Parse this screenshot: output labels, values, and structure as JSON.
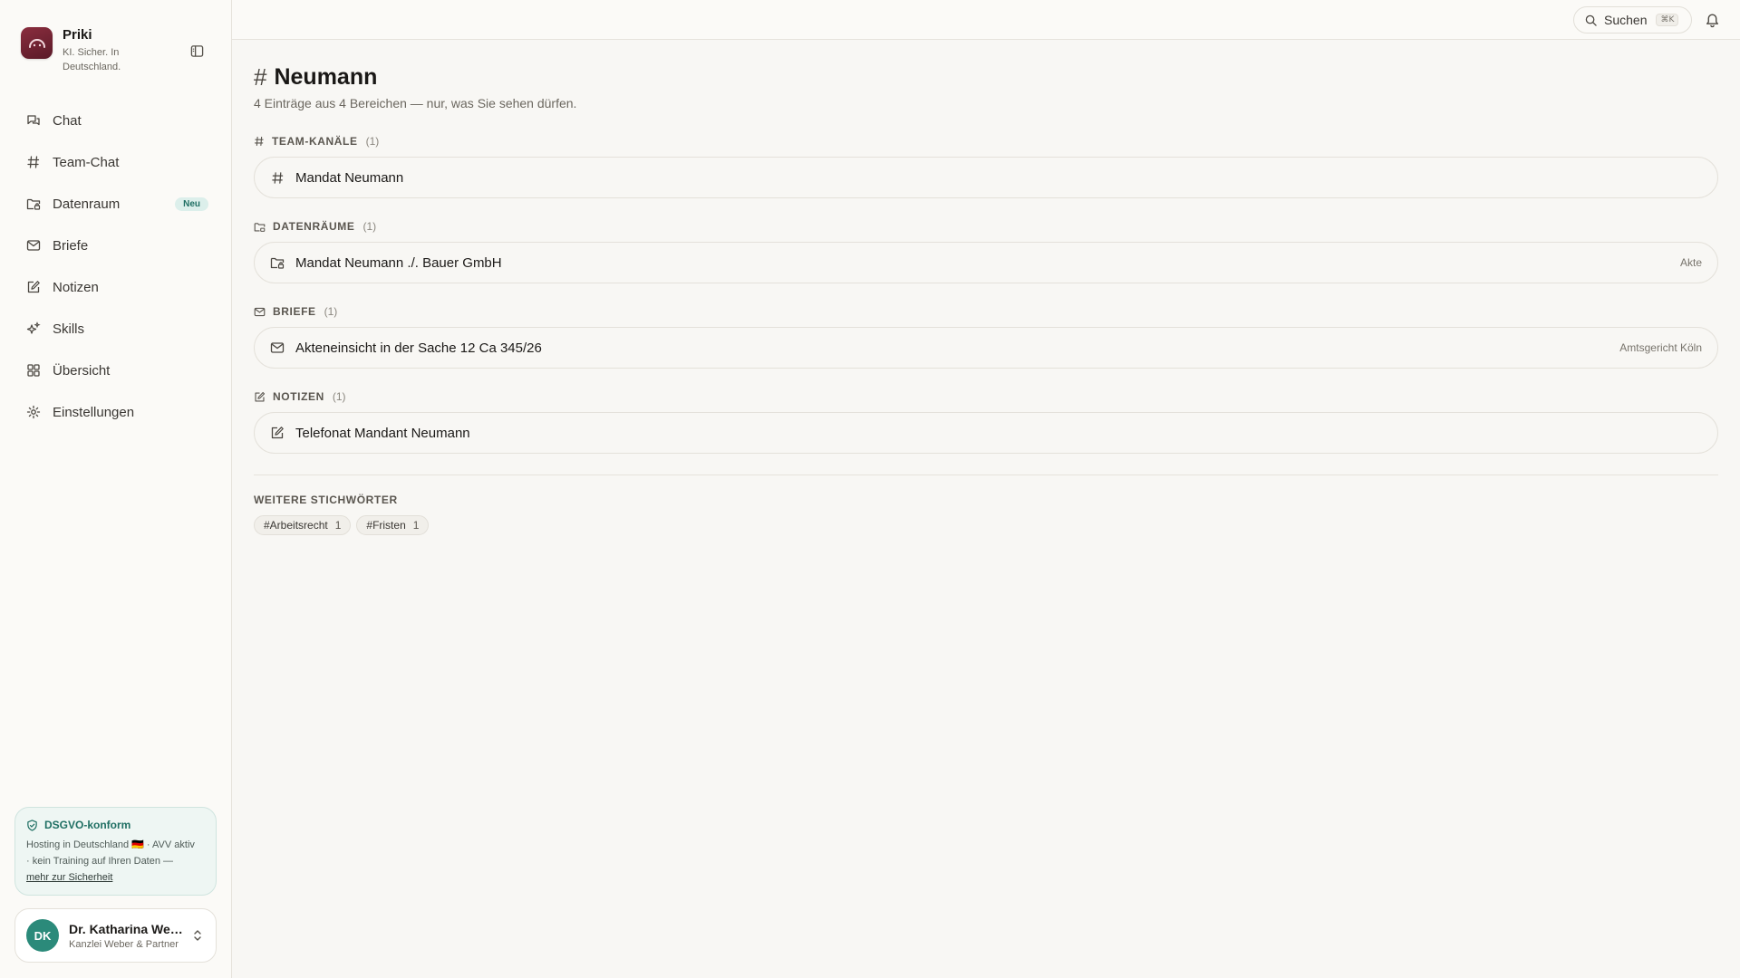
{
  "brand": {
    "name": "Priki",
    "tagline": "KI. Sicher. In Deutschland."
  },
  "nav": {
    "items": [
      {
        "label": "Chat",
        "icon": "chat-icon"
      },
      {
        "label": "Team-Chat",
        "icon": "hash-icon"
      },
      {
        "label": "Datenraum",
        "icon": "folder-lock-icon",
        "badge": "Neu"
      },
      {
        "label": "Briefe",
        "icon": "mail-icon"
      },
      {
        "label": "Notizen",
        "icon": "note-edit-icon"
      },
      {
        "label": "Skills",
        "icon": "sparkles-icon"
      },
      {
        "label": "Übersicht",
        "icon": "grid-icon"
      },
      {
        "label": "Einstellungen",
        "icon": "gear-icon"
      }
    ]
  },
  "security": {
    "title": "DSGVO-konform",
    "text_line1": "Hosting in Deutschland 🇩🇪 · AVV aktiv",
    "text_line2": "· kein Training auf Ihren Daten —",
    "link": "mehr zur Sicherheit",
    "accent": "#1f6f63"
  },
  "user": {
    "initials": "DK",
    "name": "Dr. Katharina Weber",
    "org": "Kanzlei Weber & Partner",
    "avatar_color": "#2b8a7a"
  },
  "topbar": {
    "search_label": "Suchen",
    "search_shortcut": "⌘K"
  },
  "page": {
    "title": "Neumann",
    "subtitle": "4 Einträge aus 4 Bereichen — nur, was Sie sehen dürfen."
  },
  "sections": {
    "team": {
      "heading": "TEAM-KANÄLE",
      "count": "(1)",
      "item": {
        "title": "Mandat Neumann",
        "meta": ""
      }
    },
    "rooms": {
      "heading": "DATENRÄUME",
      "count": "(1)",
      "item": {
        "title": "Mandat Neumann ./. Bauer GmbH",
        "meta": "Akte"
      }
    },
    "letters": {
      "heading": "BRIEFE",
      "count": "(1)",
      "item": {
        "title": "Akteneinsicht in der Sache 12 Ca 345/26",
        "meta": "Amtsgericht Köln"
      }
    },
    "notes": {
      "heading": "NOTIZEN",
      "count": "(1)",
      "item": {
        "title": "Telefonat Mandant Neumann",
        "meta": ""
      }
    }
  },
  "keywords": {
    "heading": "WEITERE STICHWÖRTER",
    "tags": [
      {
        "label": "#Arbeitsrecht",
        "count": "1"
      },
      {
        "label": "#Fristen",
        "count": "1"
      }
    ]
  }
}
